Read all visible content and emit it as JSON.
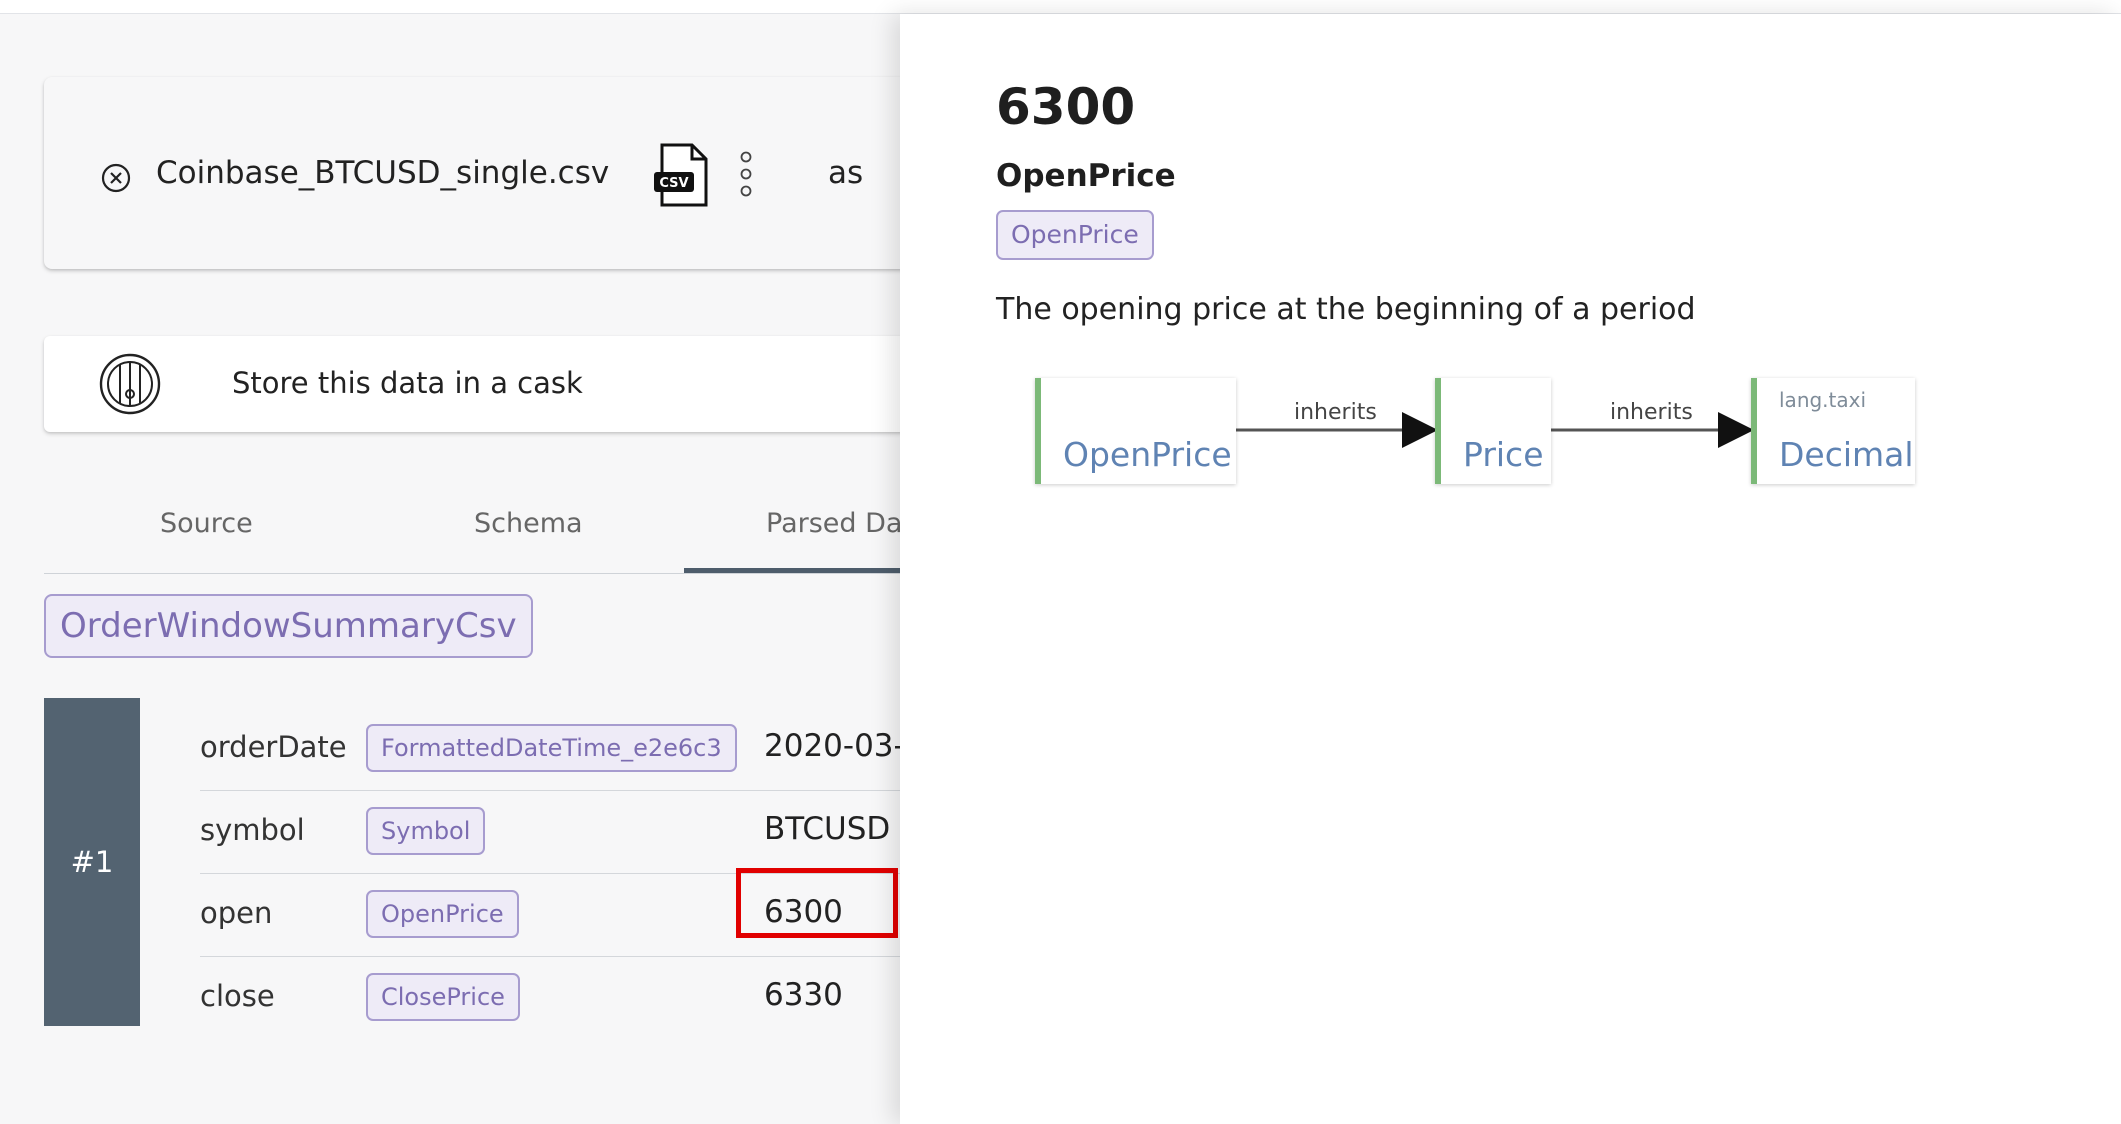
{
  "file": {
    "name": "Coinbase_BTCUSD_single.csv",
    "file_type_icon": "csv-file-icon",
    "file_type_text": "CSV",
    "as_label": "as"
  },
  "cask": {
    "label": "Store this data in a cask",
    "icon": "cask-barrel-icon"
  },
  "tabs": [
    {
      "label": "Source",
      "active": false
    },
    {
      "label": "Schema",
      "active": false
    },
    {
      "label": "Parsed Da",
      "active": true
    }
  ],
  "parsed": {
    "type_name": "OrderWindowSummaryCsv",
    "record_label": "#1",
    "rows": [
      {
        "field": "orderDate",
        "type": "FormattedDateTime_e2e6c3",
        "value": "2020-03-"
      },
      {
        "field": "symbol",
        "type": "Symbol",
        "value": "BTCUSD"
      },
      {
        "field": "open",
        "type": "OpenPrice",
        "value": "6300",
        "highlighted": true
      },
      {
        "field": "close",
        "type": "ClosePrice",
        "value": "6330"
      }
    ]
  },
  "drawer": {
    "value": "6300",
    "type_title": "OpenPrice",
    "type_chip": "OpenPrice",
    "description": "The opening price at the beginning of a period",
    "lineage": {
      "nodes": [
        {
          "label": "OpenPrice",
          "namespace": ""
        },
        {
          "label": "Price",
          "namespace": ""
        },
        {
          "label": "Decimal",
          "namespace": "lang.taxi"
        }
      ],
      "edges": [
        {
          "label": "inherits"
        },
        {
          "label": "inherits"
        }
      ]
    }
  },
  "colors": {
    "accent_chip_border": "#a79ccf",
    "accent_chip_bg": "#eeebf7",
    "accent_chip_text": "#7c6db1",
    "record_index_bg": "#536371",
    "highlight": "#e10000",
    "lineage_node_border": "#7cb978",
    "lineage_node_text": "#5f83b3"
  }
}
